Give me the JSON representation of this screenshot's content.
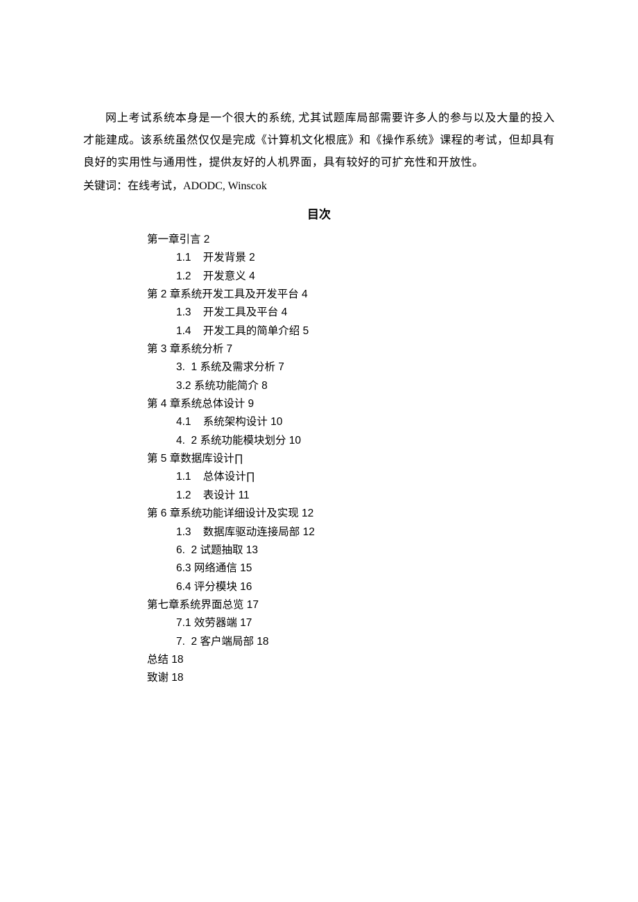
{
  "intro_paragraph": "网上考试系统本身是一个很大的系统, 尤其试题库局部需要许多人的参与以及大量的投入才能建成。该系统虽然仅仅是完成《计算机文化根底》和《操作系统》课程的考试，但却具有良好的实用性与通用性，提供友好的人机界面，具有较好的可扩充性和开放性。",
  "keywords_line": "关键词：在线考试，ADODC, Winscok",
  "toc_title": "目次",
  "toc_entries": [
    {
      "level": 1,
      "text": "第一章引言 2"
    },
    {
      "level": 2,
      "text": "1.1    开发背景 2"
    },
    {
      "level": 2,
      "text": "1.2    开发意义 4"
    },
    {
      "level": 1,
      "text": "第 2 章系统开发工具及开发平台 4"
    },
    {
      "level": 2,
      "text": "1.3    开发工具及平台 4"
    },
    {
      "level": 2,
      "text": "1.4    开发工具的简单介绍 5"
    },
    {
      "level": 1,
      "text": "第 3 章系统分析 7"
    },
    {
      "level": 2,
      "text": "3.  1 系统及需求分析 7"
    },
    {
      "level": 2,
      "text": "3.2 系统功能简介 8"
    },
    {
      "level": 1,
      "text": "第 4 章系统总体设计 9"
    },
    {
      "level": 2,
      "text": "4.1    系统架构设计 10"
    },
    {
      "level": 2,
      "text": "4.  2 系统功能模块划分 10"
    },
    {
      "level": 1,
      "text": "第 5 章数据库设计∏"
    },
    {
      "level": 2,
      "text": "1.1    总体设计∏"
    },
    {
      "level": 2,
      "text": "1.2    表设计 11"
    },
    {
      "level": 1,
      "text": "第 6 章系统功能详细设计及实现 12"
    },
    {
      "level": 2,
      "text": "1.3    数据库驱动连接局部 12"
    },
    {
      "level": 2,
      "text": "6.  2 试题抽取 13"
    },
    {
      "level": 2,
      "text": "6.3 网络通信 15"
    },
    {
      "level": 2,
      "text": "6.4 评分模块 16"
    },
    {
      "level": 1,
      "text": "第七章系统界面总览 17"
    },
    {
      "level": 2,
      "text": "7.1 效劳器端 17"
    },
    {
      "level": 2,
      "text": "7.  2 客户端局部 18"
    },
    {
      "level": 1,
      "text": "总结 18"
    },
    {
      "level": 1,
      "text": "致谢 18"
    }
  ]
}
